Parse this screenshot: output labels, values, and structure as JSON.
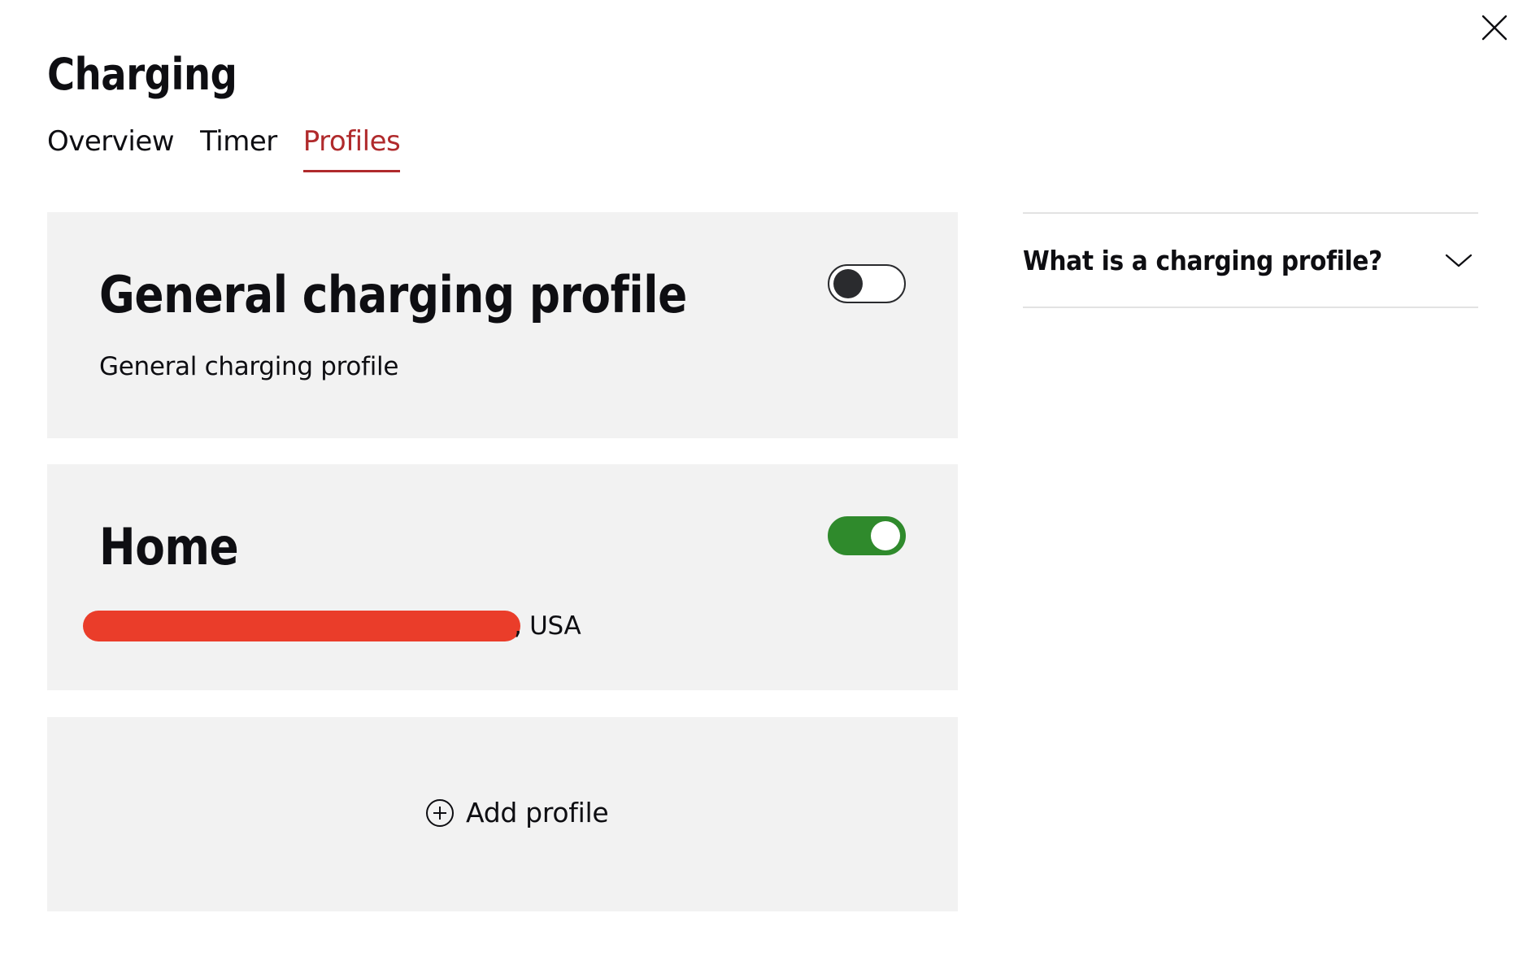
{
  "header": {
    "title": "Charging",
    "close_icon": "close-icon"
  },
  "tabs": [
    {
      "label": "Overview",
      "active": false
    },
    {
      "label": "Timer",
      "active": false
    },
    {
      "label": "Profiles",
      "active": true
    }
  ],
  "profiles": [
    {
      "title": "General charging profile",
      "subtitle": "General charging profile",
      "enabled": false
    },
    {
      "title": "Home",
      "address_suffix": ", USA",
      "enabled": true
    }
  ],
  "add_profile": {
    "label": "Add profile",
    "icon": "plus-circle-icon"
  },
  "faq": {
    "label": "What is a charging profile?",
    "icon": "chevron-down-icon"
  },
  "colors": {
    "accent": "#b02a2c",
    "toggle_on": "#2f8a2c",
    "card_background": "#f2f2f2",
    "redaction": "#ea3d2a"
  }
}
